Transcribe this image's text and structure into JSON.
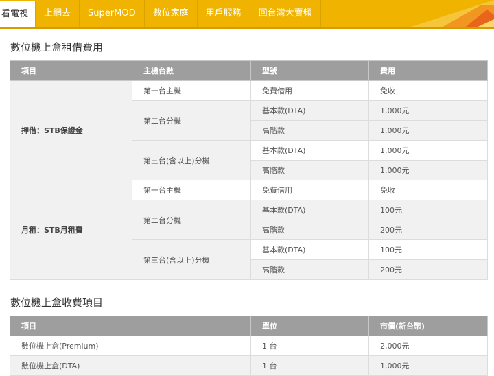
{
  "nav": {
    "tabs": [
      {
        "label": "看電視",
        "active": true
      },
      {
        "label": "上網去"
      },
      {
        "label": "SuperMOD"
      },
      {
        "label": "數位家庭"
      },
      {
        "label": "用戶服務"
      },
      {
        "label": "回台灣大賣頻"
      }
    ],
    "colors": {
      "bar": "#f0b400",
      "accent": "#e8651a"
    }
  },
  "rental": {
    "title": "數位機上盒租借費用",
    "headers": [
      "項目",
      "主機台數",
      "型號",
      "費用"
    ],
    "groups": [
      {
        "item": "押借：STB保證金",
        "units": [
          {
            "count": "第一台主機",
            "rows": [
              {
                "model": "免費借用",
                "fee": "免收"
              }
            ]
          },
          {
            "count": "第二台分機",
            "rows": [
              {
                "model": "基本款(DTA)",
                "fee": "1,000元"
              },
              {
                "model": "高階款",
                "fee": "1,000元"
              }
            ]
          },
          {
            "count": "第三台(含以上)分機",
            "rows": [
              {
                "model": "基本款(DTA)",
                "fee": "1,000元"
              },
              {
                "model": "高階款",
                "fee": "1,000元"
              }
            ]
          }
        ]
      },
      {
        "item": "月租：STB月租費",
        "units": [
          {
            "count": "第一台主機",
            "rows": [
              {
                "model": "免費借用",
                "fee": "免收"
              }
            ]
          },
          {
            "count": "第二台分機",
            "rows": [
              {
                "model": "基本款(DTA)",
                "fee": "100元"
              },
              {
                "model": "高階款",
                "fee": "200元"
              }
            ]
          },
          {
            "count": "第三台(含以上)分機",
            "rows": [
              {
                "model": "基本款(DTA)",
                "fee": "100元"
              },
              {
                "model": "高階款",
                "fee": "200元"
              }
            ]
          }
        ]
      }
    ]
  },
  "charges": {
    "title": "數位機上盒收費項目",
    "headers": [
      "項目",
      "單位",
      "市價(新台幣)"
    ],
    "rows": [
      {
        "item": "數位機上盒(Premium)",
        "unit": "1 台",
        "price": "2,000元"
      },
      {
        "item": "數位機上盒(DTA)",
        "unit": "1 台",
        "price": "1,000元"
      }
    ]
  }
}
